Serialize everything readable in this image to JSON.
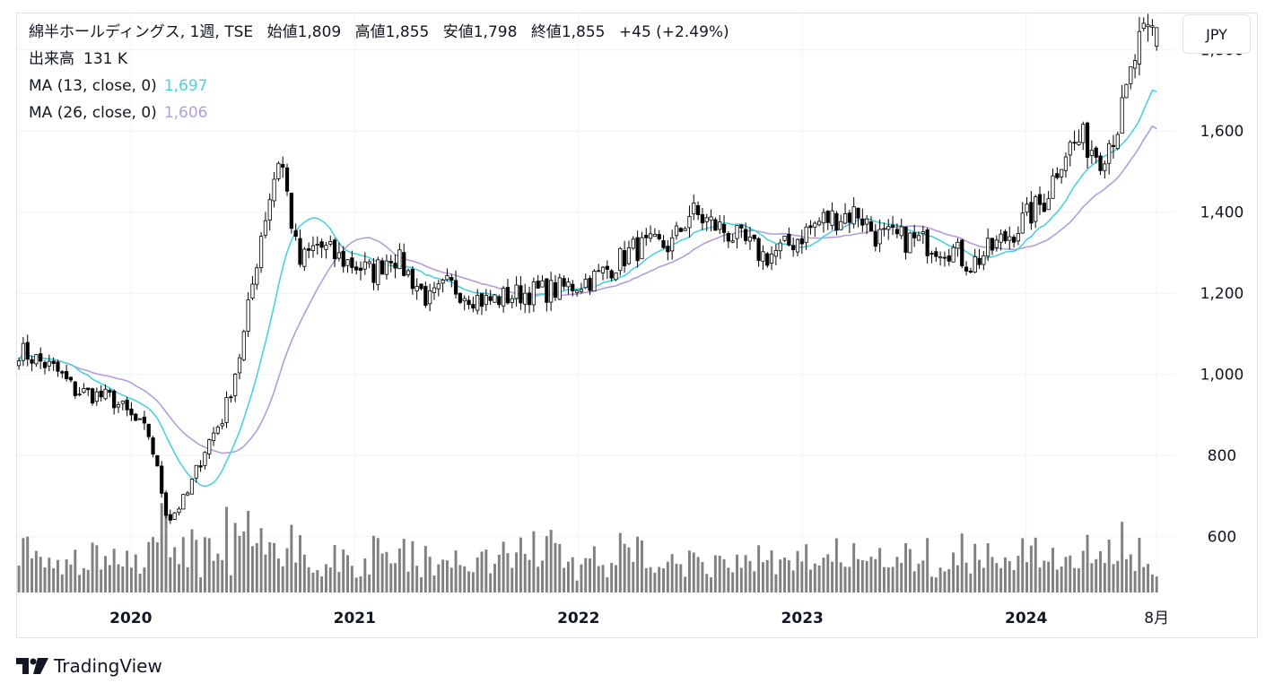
{
  "header": {
    "symbol": "綿半ホールディングス, 1週, TSE",
    "open_label": "始値",
    "open": "1,809",
    "high_label": "高値",
    "high": "1,855",
    "low_label": "安値",
    "low": "1,798",
    "close_label": "終値",
    "close": "1,855",
    "change": "+45 (+2.49%)"
  },
  "volume": {
    "label": "出来高",
    "value": "131 K"
  },
  "indicators": [
    {
      "label": "MA (13, close, 0)",
      "value": "1,697",
      "color": "#4dd0e1"
    },
    {
      "label": "MA (26, close, 0)",
      "value": "1,606",
      "color": "#b39ddb"
    }
  ],
  "currency": "JPY",
  "branding": "TradingView",
  "colors": {
    "up_body": "#ffffff",
    "down_body": "#000000",
    "wick": "#000000",
    "volume": "#808080",
    "grid": "#f0f3fa"
  },
  "chart_data": {
    "type": "candlestick",
    "interval": "1週",
    "y_ticks": [
      600,
      800,
      1000,
      1200,
      1400,
      1600,
      1800
    ],
    "y_tick_labels": [
      "600",
      "800",
      "1,000",
      "1,200",
      "1,400",
      "1,600",
      "1,800"
    ],
    "ylim": [
      460,
      1890
    ],
    "x_tick_labels": [
      "2020",
      "2021",
      "2022",
      "2023",
      "2024",
      "8月"
    ],
    "x_tick_dates": [
      "2020-01",
      "2021-01",
      "2022-01",
      "2023-01",
      "2024-01",
      "2024-08"
    ],
    "close_anchors": [
      [
        "2019-07",
        1060
      ],
      [
        "2019-09",
        1010
      ],
      [
        "2019-10",
        960
      ],
      [
        "2019-12",
        940
      ],
      [
        "2020-02",
        850
      ],
      [
        "2020-03",
        640
      ],
      [
        "2020-04",
        700
      ],
      [
        "2020-05",
        820
      ],
      [
        "2020-06",
        900
      ],
      [
        "2020-07",
        1080
      ],
      [
        "2020-08",
        1350
      ],
      [
        "2020-09",
        1550
      ],
      [
        "2020-10",
        1270
      ],
      [
        "2020-11",
        1320
      ],
      [
        "2020-12",
        1290
      ],
      [
        "2021-02",
        1250
      ],
      [
        "2021-03",
        1300
      ],
      [
        "2021-05",
        1180
      ],
      [
        "2021-06",
        1220
      ],
      [
        "2021-08",
        1180
      ],
      [
        "2021-10",
        1200
      ],
      [
        "2021-12",
        1210
      ],
      [
        "2022-02",
        1240
      ],
      [
        "2022-04",
        1310
      ],
      [
        "2022-06",
        1320
      ],
      [
        "2022-07",
        1400
      ],
      [
        "2022-09",
        1350
      ],
      [
        "2022-11",
        1290
      ],
      [
        "2022-12",
        1310
      ],
      [
        "2023-02",
        1380
      ],
      [
        "2023-04",
        1400
      ],
      [
        "2023-05",
        1340
      ],
      [
        "2023-07",
        1330
      ],
      [
        "2023-09",
        1310
      ],
      [
        "2023-10",
        1270
      ],
      [
        "2023-12",
        1340
      ],
      [
        "2024-02",
        1430
      ],
      [
        "2024-03",
        1550
      ],
      [
        "2024-04",
        1580
      ],
      [
        "2024-05",
        1540
      ],
      [
        "2024-06",
        1620
      ],
      [
        "2024-07",
        1810
      ],
      [
        "2024-08",
        1855
      ]
    ],
    "last_bar": {
      "open": 1809,
      "high": 1855,
      "low": 1798,
      "close": 1855,
      "volume": 131000
    },
    "ma13_last": 1697,
    "ma26_last": 1606
  }
}
